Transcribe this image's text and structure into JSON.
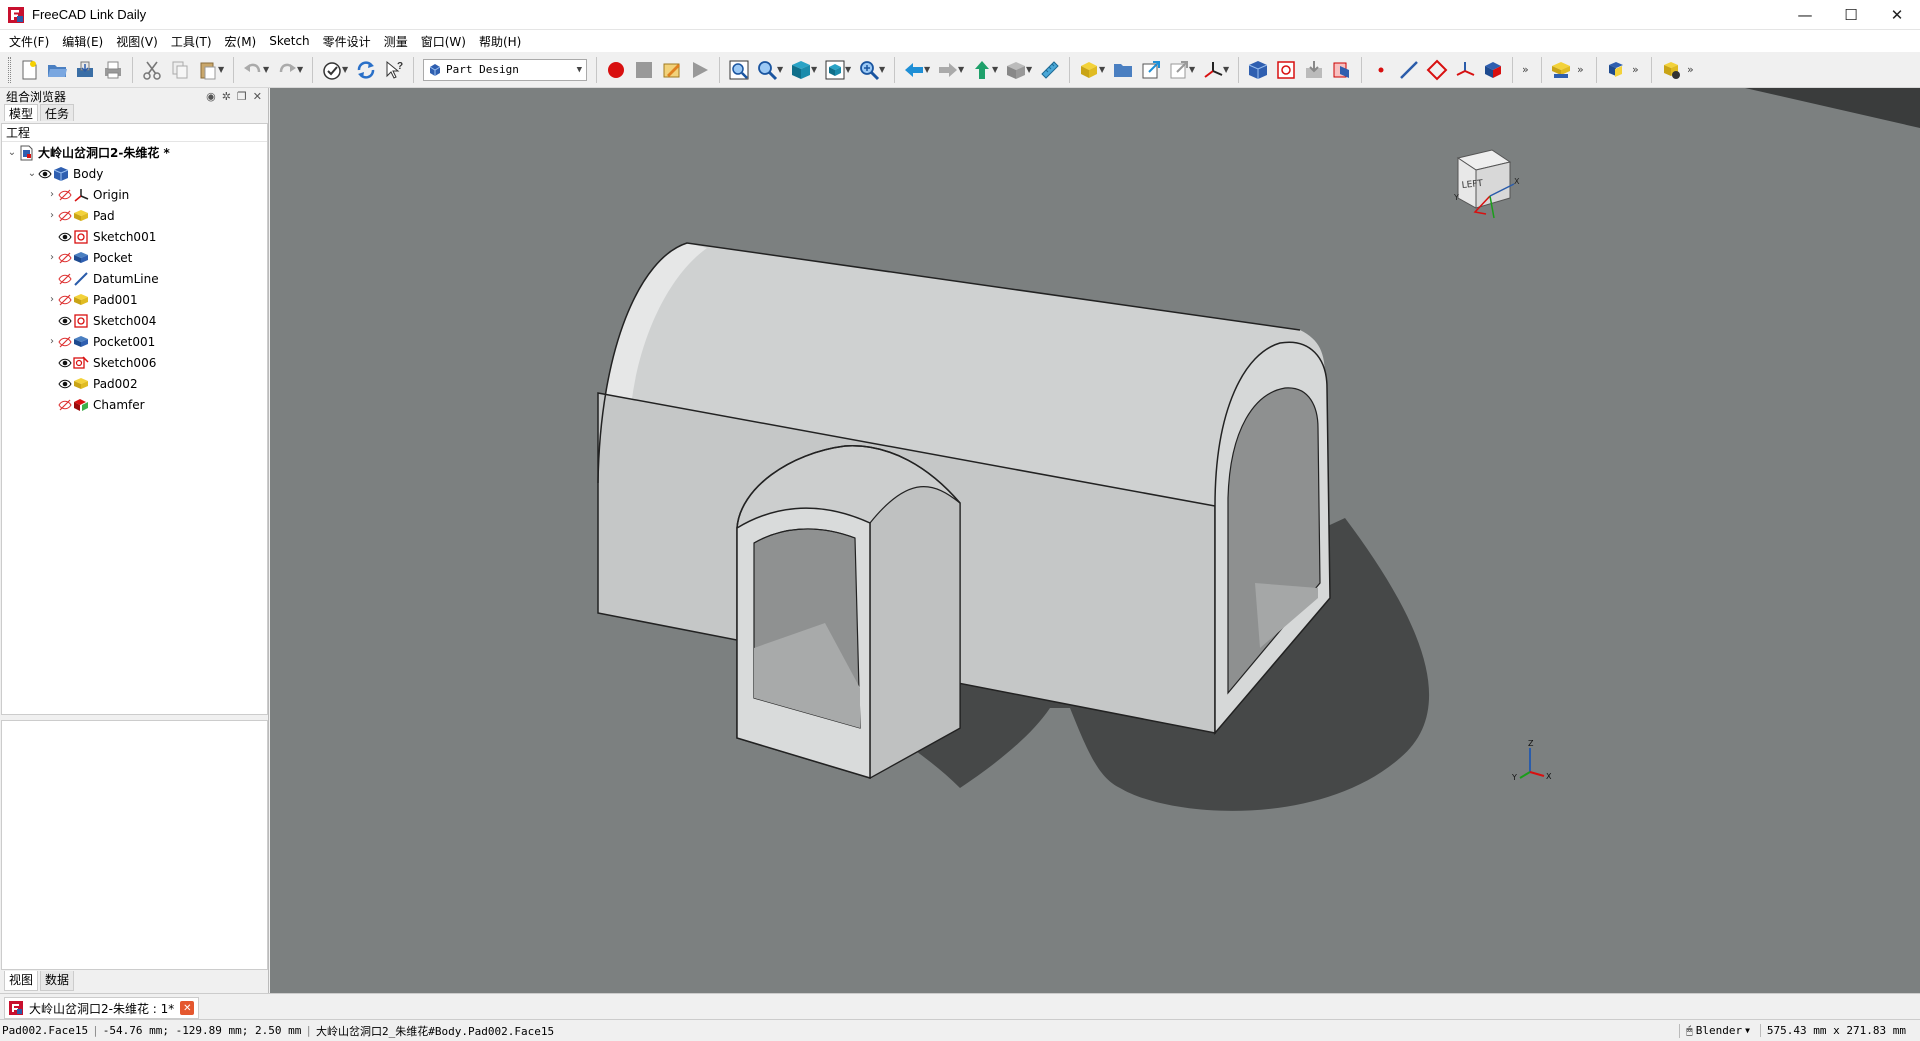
{
  "window": {
    "title": "FreeCAD Link Daily",
    "controls": [
      "—",
      "☐",
      "✕"
    ]
  },
  "menu": [
    "文件(F)",
    "编辑(E)",
    "视图(V)",
    "工具(T)",
    "宏(M)",
    "Sketch",
    "零件设计",
    "测量",
    "窗口(W)",
    "帮助(H)"
  ],
  "toolbar": {
    "workbench": "Part Design",
    "overflow": "»"
  },
  "left_panel": {
    "title": "组合浏览器",
    "tabs": [
      "模型",
      "任务"
    ],
    "tree_header": "工程",
    "bottom_tabs": [
      "视图",
      "数据"
    ],
    "tree": [
      {
        "label": "大岭山岔洞口2-朱维花 *",
        "level": 0,
        "expanded": true,
        "icon": "document-icon",
        "bold": true
      },
      {
        "label": "Body",
        "level": 1,
        "expanded": true,
        "icon": "body-icon",
        "visible": true
      },
      {
        "label": "Origin",
        "level": 2,
        "collapsed": true,
        "icon": "origin-icon",
        "visible": false
      },
      {
        "label": "Pad",
        "level": 2,
        "collapsed": true,
        "icon": "pad-icon",
        "visible": false
      },
      {
        "label": "Sketch001",
        "level": 2,
        "icon": "sketch-icon",
        "visible": true
      },
      {
        "label": "Pocket",
        "level": 2,
        "collapsed": true,
        "icon": "pocket-icon",
        "visible": false
      },
      {
        "label": "DatumLine",
        "level": 2,
        "icon": "datumline-icon",
        "visible": false
      },
      {
        "label": "Pad001",
        "level": 2,
        "collapsed": true,
        "icon": "pad-icon",
        "visible": false
      },
      {
        "label": "Sketch004",
        "level": 2,
        "icon": "sketch-icon",
        "visible": true
      },
      {
        "label": "Pocket001",
        "level": 2,
        "collapsed": true,
        "icon": "pocket-icon",
        "visible": false
      },
      {
        "label": "Sketch006",
        "level": 2,
        "icon": "sketch-attached-icon",
        "visible": true
      },
      {
        "label": "Pad002",
        "level": 2,
        "icon": "pad-icon",
        "visible": true
      },
      {
        "label": "Chamfer",
        "level": 2,
        "icon": "chamfer-icon",
        "visible": false
      }
    ]
  },
  "view3d": {
    "navcube_face": "LEFT",
    "axis_labels": {
      "x": "X",
      "y": "Y",
      "z": "Z"
    },
    "colors": {
      "background": "#7c8080",
      "shadow": "#464848",
      "model_light": "#dcdcdc",
      "model_mid": "#c8c8c8",
      "model_dark": "#a8a8a8"
    }
  },
  "doc_tab": {
    "label": "大岭山岔洞口2-朱维花 : 1*",
    "close": "✕"
  },
  "status": {
    "selection": "Pad002.Face15",
    "coords": "-54.76 mm; -129.89 mm; 2.50 mm",
    "preselection": "大岭山岔洞口2_朱维花#Body.Pad002.Face15",
    "nav_style": "Blender",
    "dimensions": "575.43 mm x 271.83 mm"
  }
}
